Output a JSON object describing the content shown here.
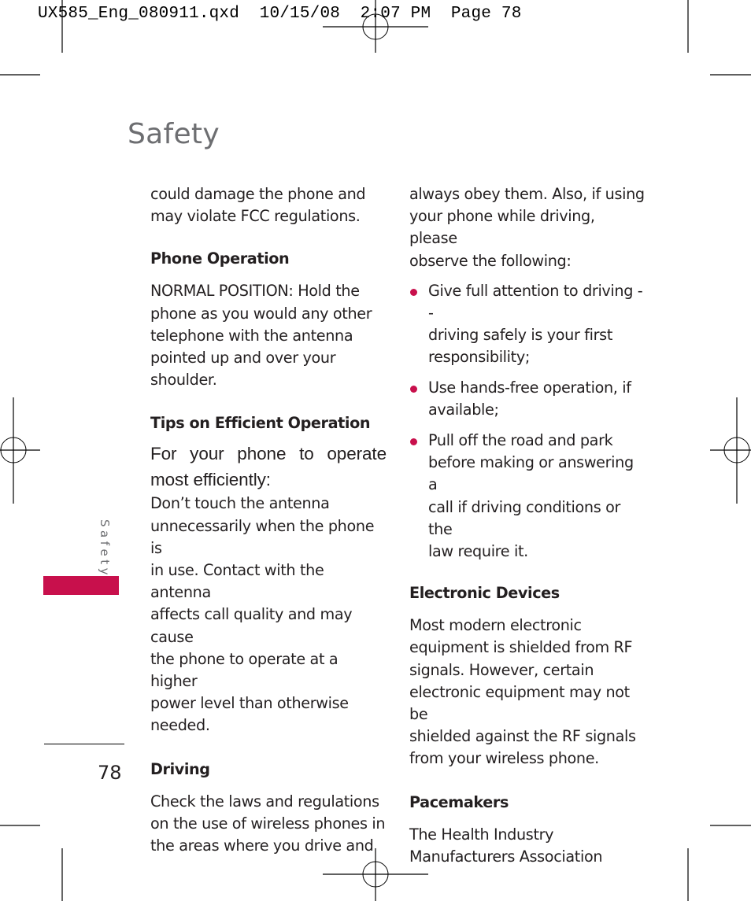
{
  "slug_line": "UX585_Eng_080911.qxd  10/15/08  2:07 PM  Page 78",
  "page": {
    "title": "Safety",
    "side_tab_label": "Safety",
    "side_tab_color": "#c8104c",
    "bullet_color": "#c8104c",
    "page_number": "78"
  },
  "left_column": {
    "intro": [
      "could damage the phone and",
      "may violate FCC regulations."
    ],
    "phone_operation": {
      "heading": "Phone Operation",
      "body": [
        "NORMAL POSITION: Hold the",
        "phone as you would any other",
        "telephone with the antenna",
        "pointed up and over your",
        "shoulder."
      ]
    },
    "tips": {
      "heading": "Tips on Efficient Operation",
      "lead": [
        "For your phone to operate",
        "most efficiently:"
      ],
      "body": [
        "Don’t touch the antenna",
        "unnecessarily when the phone is",
        "in use. Contact with the antenna",
        "affects call quality and may cause",
        "the phone to operate at a higher",
        "power level than otherwise",
        "needed."
      ]
    },
    "driving": {
      "heading": "Driving",
      "body": [
        "Check the laws and regulations",
        "on the use of wireless phones in",
        "the areas where you drive and"
      ]
    }
  },
  "right_column": {
    "intro": [
      "always obey them. Also, if using",
      "your phone while driving, please",
      "observe the following:"
    ],
    "bullets": [
      [
        "Give full attention to driving --",
        "driving safely is your first",
        "responsibility;"
      ],
      [
        "Use hands-free operation, if",
        "available;"
      ],
      [
        "Pull off the road and park",
        "before making or answering a",
        "call if driving conditions or the",
        "law require it."
      ]
    ],
    "electronic_devices": {
      "heading": "Electronic Devices",
      "body": [
        "Most modern electronic",
        "equipment is shielded from RF",
        "signals. However, certain",
        "electronic equipment may not be",
        "shielded against the RF signals",
        "from your wireless phone."
      ]
    },
    "pacemakers": {
      "heading": "Pacemakers",
      "body": [
        "The Health Industry",
        "Manufacturers Association"
      ]
    }
  }
}
